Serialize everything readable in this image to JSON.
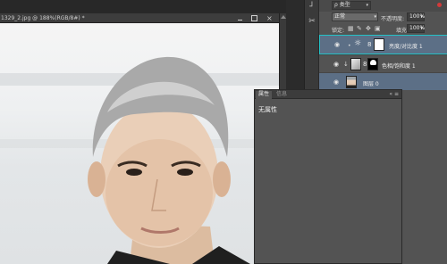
{
  "document": {
    "tab_title": "1329_2.jpg @ 188%(RGB/8#) *",
    "min_icon": "minimize-icon",
    "max_icon": "maximize-icon",
    "close_label": "×"
  },
  "layers_panel": {
    "filter_value": "ρ 类型",
    "blend_mode": "正常",
    "opacity_label": "不透明度:",
    "opacity_value": "100%",
    "lock_label": "锁定:",
    "fill_label": "填充:",
    "fill_value": "100%",
    "layers": [
      {
        "name": "亮度/对比度 1",
        "type": "adjustment",
        "selected": true,
        "visible": true
      },
      {
        "name": "色相/饱和度 1",
        "type": "adjustment-clipped",
        "selected": false,
        "visible": true
      },
      {
        "name": "图层 0",
        "type": "image",
        "selected": false,
        "visible": true
      }
    ]
  },
  "properties_panel": {
    "tabs": [
      "属性",
      "信息"
    ],
    "active_tab": "属性",
    "empty_text": "无属性",
    "menu_icon": "panel-menu-icon",
    "collapse_icon": "collapse-icon"
  },
  "colors": {
    "accent_selected_border": "#25c1c6",
    "selected_layer_bg": "#5c6f86",
    "panel_bg": "#535353",
    "app_bg": "#282828"
  }
}
